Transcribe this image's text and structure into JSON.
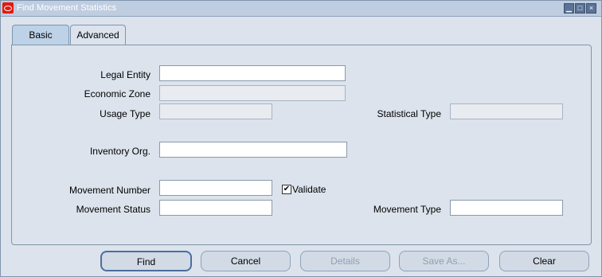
{
  "window": {
    "title": "Find  Movement Statistics"
  },
  "tabs": [
    {
      "label": "Basic"
    },
    {
      "label": "Advanced"
    }
  ],
  "fields": {
    "legal_entity": {
      "label": "Legal Entity",
      "value": ""
    },
    "economic_zone": {
      "label": "Economic Zone",
      "value": ""
    },
    "usage_type": {
      "label": "Usage Type",
      "value": ""
    },
    "statistical_type": {
      "label": "Statistical Type",
      "value": ""
    },
    "inventory_org": {
      "label": "Inventory Org.",
      "value": ""
    },
    "movement_number": {
      "label": "Movement Number",
      "value": ""
    },
    "movement_status": {
      "label": "Movement Status",
      "value": ""
    },
    "movement_type": {
      "label": "Movement Type",
      "value": ""
    }
  },
  "checkbox": {
    "label": "Validate",
    "checked": true
  },
  "buttons": {
    "find": "Find",
    "cancel": "Cancel",
    "details": "Details",
    "save_as": "Save As...",
    "clear": "Clear"
  },
  "colors": {
    "title_bar": "#bfcde0",
    "panel": "#dce3ec",
    "logo": "#e21a0f"
  }
}
